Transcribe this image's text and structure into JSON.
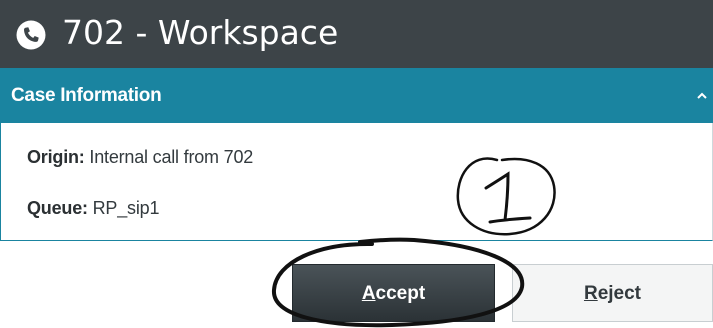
{
  "window": {
    "title": "702 - Workspace",
    "icon": "phone-icon"
  },
  "case_panel": {
    "header": "Case Information",
    "toggle_icon": "chevron-up-icon",
    "fields": [
      {
        "label": "Origin:",
        "value": "Internal call from 702"
      },
      {
        "label": "Queue:",
        "value": "RP_sip1"
      }
    ]
  },
  "actions": {
    "accept": {
      "mnemonic": "A",
      "rest": "ccept"
    },
    "reject": {
      "mnemonic": "R",
      "rest": "eject"
    }
  },
  "annotation": {
    "step_number": "1"
  },
  "colors": {
    "titlebar": "#3d4448",
    "case_header": "#1a84a0",
    "accept_button": "#2b3236"
  }
}
